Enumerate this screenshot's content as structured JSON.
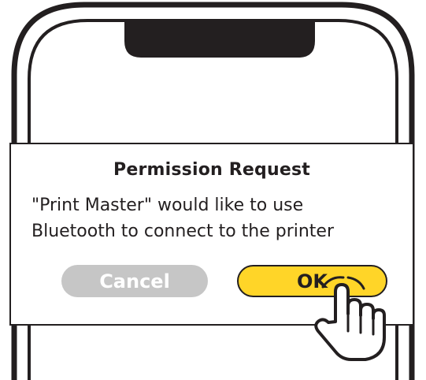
{
  "dialog": {
    "title": "Permission Request",
    "message_line1": "\"Print Master\" would like to use",
    "message_line2": "Bluetooth to connect to the printer",
    "cancel_label": "Cancel",
    "ok_label": "OK"
  },
  "colors": {
    "ok_button": "#ffd528",
    "cancel_button": "#c6c6c6",
    "outline": "#231f20"
  },
  "icons": {
    "phone": "phone-outline-icon",
    "notch": "phone-notch-icon",
    "hand": "tapping-hand-icon"
  }
}
